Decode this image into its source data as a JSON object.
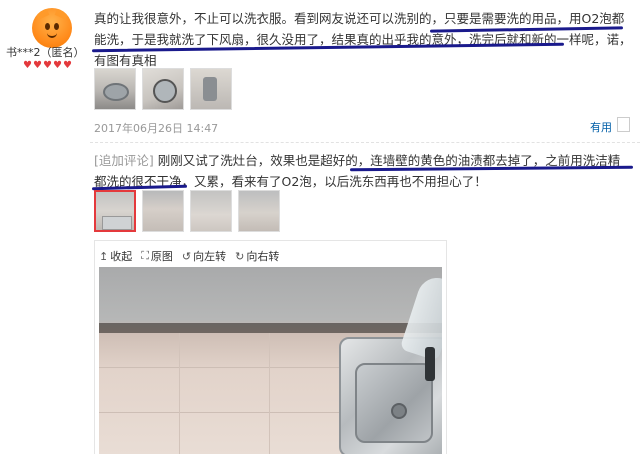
{
  "user": {
    "avatar_icon": "orange-cartoon-avatar-icon",
    "name": "书***2（匿名）",
    "badge_icon": "red-heart-icon",
    "badge_count": 5
  },
  "review": {
    "text": "真的让我很意外，不止可以洗衣服。看到网友说还可以洗别的，只要是需要洗的用品，用O2泡都能洗，于是我就洗了下风扇，很久没用了，结果真的出乎我的意外，洗完后就和新的一样呢，诺，有图有真相",
    "images": [
      "风扇图1",
      "风扇图2",
      "风扇图3"
    ],
    "date": "2017年06月26日 14:47",
    "useful_label": "有用",
    "useful_count": ""
  },
  "append": {
    "tag": "[追加评论]",
    "text": "刚刚又试了洗灶台，效果也是超好的，连墙壁的黄色的油渍都去掉了，之前用洗洁精都洗的很不干净，又累，看来有了O2泡，以后洗东西再也不用担心了！",
    "images": [
      "灶台图1",
      "灶台图2",
      "灶台图3",
      "灶台图4"
    ],
    "active_index": 0
  },
  "viewer": {
    "tools": [
      {
        "icon": "arrow-up-icon",
        "glyph": "↥",
        "label": "收起"
      },
      {
        "icon": "expand-icon",
        "glyph": "⛶",
        "label": "原图"
      },
      {
        "icon": "rotate-left-icon",
        "glyph": "↺",
        "label": "向左转"
      },
      {
        "icon": "rotate-right-icon",
        "glyph": "↻",
        "label": "向右转"
      }
    ],
    "photo": "灶台大图"
  },
  "colors": {
    "underline": "#1a1a8c",
    "badge": "#e4393c",
    "link": "#005ea7",
    "muted": "#999999"
  }
}
